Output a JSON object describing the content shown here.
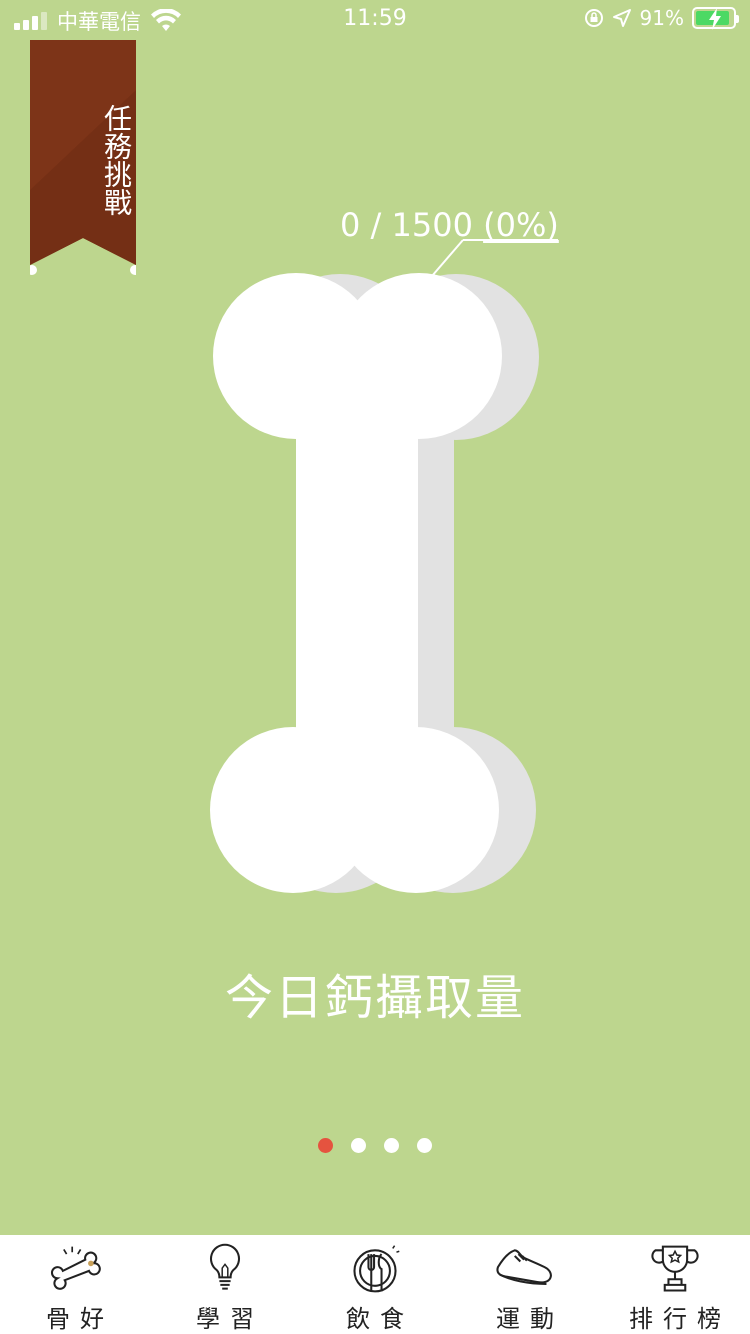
{
  "status_bar": {
    "carrier": "中華電信",
    "time": "11:59",
    "battery": "91%"
  },
  "ribbon": {
    "label": "任務挑戰"
  },
  "progress": {
    "text": "0 / 1500",
    "percent": "(0%)",
    "fraction": 0
  },
  "title": "今日鈣攝取量",
  "pager": {
    "count": 4,
    "active": 0
  },
  "tabs": [
    {
      "label": "骨好",
      "icon": "bone-icon"
    },
    {
      "label": "學習",
      "icon": "lightbulb-icon"
    },
    {
      "label": "飲食",
      "icon": "plate-utensils-icon"
    },
    {
      "label": "運動",
      "icon": "sneaker-icon"
    },
    {
      "label": "排行榜",
      "icon": "trophy-icon"
    }
  ],
  "colors": {
    "background": "#bdd68e",
    "ribbon": "#8b3a1c",
    "active_dot": "#e5533f",
    "bone": "#ffffff",
    "bone_shadow": "#e2e2e2"
  }
}
